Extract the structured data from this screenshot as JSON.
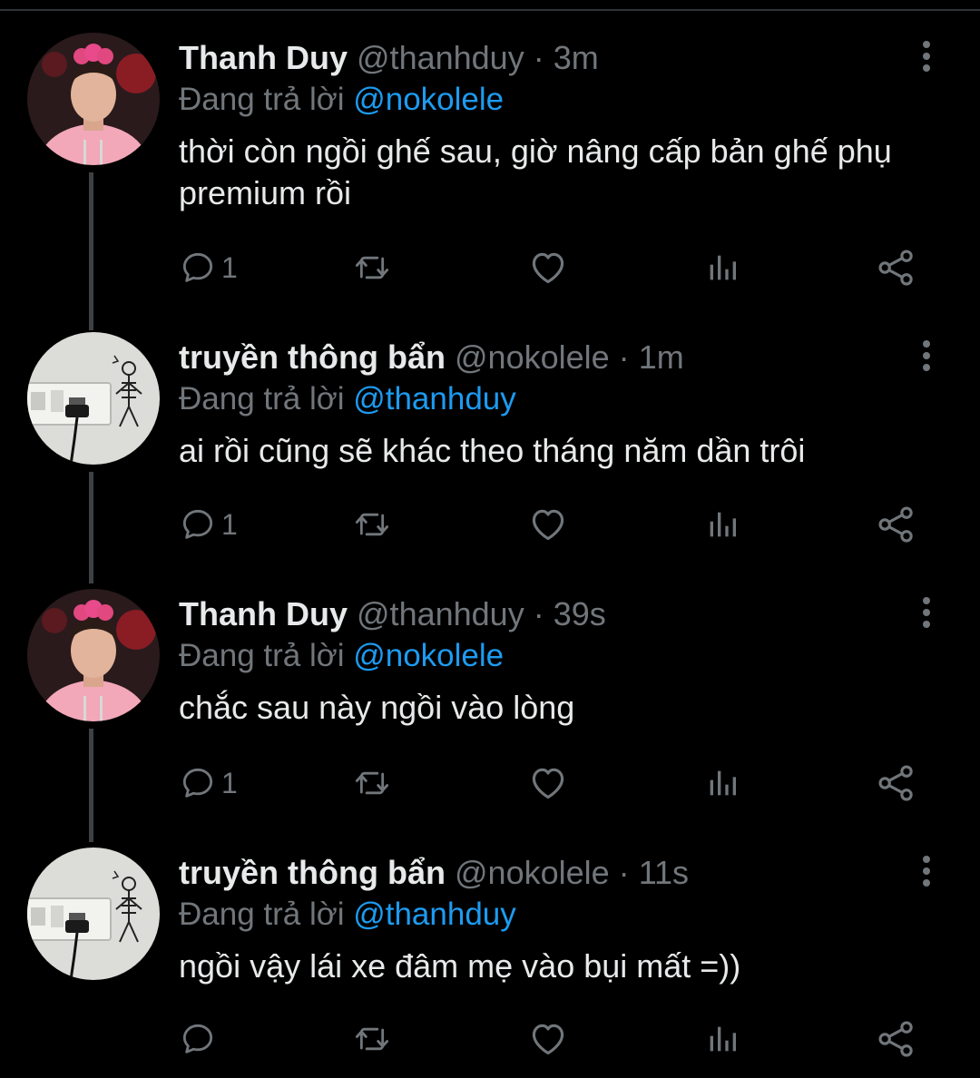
{
  "tweets": [
    {
      "display_name": "Thanh Duy",
      "handle": "@thanhduy",
      "separator": "·",
      "time": "3m",
      "reply_prefix": "Đang trả lời",
      "reply_to": "@nokolele",
      "text": "thời còn ngồi ghế sau, giờ nâng cấp bản ghế phụ premium rồi",
      "reply_count": "1",
      "avatar": "person-pink-hoodie-avatar"
    },
    {
      "display_name": "truyền thông bẩn",
      "handle": "@nokolele",
      "separator": "·",
      "time": "1m",
      "reply_prefix": "Đang trả lời",
      "reply_to": "@thanhduy",
      "text": "ai rồi cũng sẽ khác theo tháng năm dần trôi",
      "reply_count": "1",
      "avatar": "wall-outlet-skeleton-avatar"
    },
    {
      "display_name": "Thanh Duy",
      "handle": "@thanhduy",
      "separator": "·",
      "time": "39s",
      "reply_prefix": "Đang trả lời",
      "reply_to": "@nokolele",
      "text": "chắc sau này ngồi vào lòng",
      "reply_count": "1",
      "avatar": "person-pink-hoodie-avatar"
    },
    {
      "display_name": "truyền thông bẩn",
      "handle": "@nokolele",
      "separator": "·",
      "time": "11s",
      "reply_prefix": "Đang trả lời",
      "reply_to": "@thanhduy",
      "text": "ngồi vậy lái xe đâm mẹ vào bụi mất =))",
      "reply_count": "",
      "avatar": "wall-outlet-skeleton-avatar"
    }
  ],
  "icons": {
    "reply": "reply-icon",
    "retweet": "retweet-icon",
    "like": "heart-icon",
    "views": "views-icon",
    "share": "share-icon",
    "more": "more-vertical-icon"
  },
  "colors": {
    "background": "#000000",
    "primary_text": "#e7e9ea",
    "secondary_text": "#71767b",
    "mention": "#1d9bf0",
    "thread_line": "#3e4144"
  }
}
